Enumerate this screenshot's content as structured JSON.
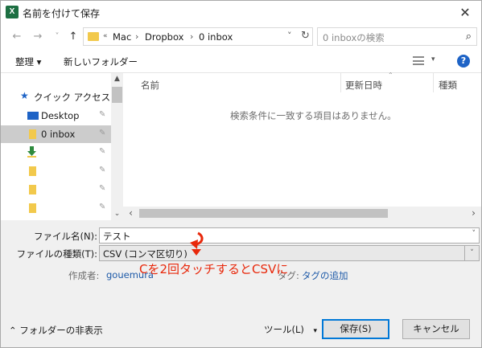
{
  "window": {
    "title": "名前を付けて保存",
    "app_icon_letter": "X",
    "close_glyph": "✕"
  },
  "nav": {
    "back_glyph": "←",
    "forward_glyph": "→",
    "recent_glyph": "˅",
    "up_glyph": "↑",
    "breadcrumb": [
      "Mac",
      "Dropbox",
      "0 inbox"
    ],
    "breadcrumb_sep": "›",
    "leading_sep": "«",
    "dropdown_glyph": "˅",
    "refresh_glyph": "↻",
    "search_placeholder": "0 inboxの検索",
    "search_glyph": "⌕"
  },
  "toolbar": {
    "organize_label": "整理 ▾",
    "new_folder_label": "新しいフォルダー",
    "view_drop_glyph": "▾",
    "help_glyph": "?"
  },
  "sidebar": {
    "items": [
      {
        "label": "クイック アクセス",
        "icon": "star-icon"
      },
      {
        "label": "Desktop",
        "icon": "desktop-icon"
      },
      {
        "label": "0 inbox",
        "icon": "folder-icon",
        "selected": true
      },
      {
        "label": "",
        "icon": "green-arrow-icon"
      },
      {
        "label": "",
        "icon": "folder-icon"
      },
      {
        "label": "",
        "icon": "folder-icon"
      },
      {
        "label": "",
        "icon": "folder-icon"
      }
    ],
    "pin_glyph": "📌",
    "scroll_up": "▲",
    "scroll_down": "⌄"
  },
  "filelist": {
    "columns": [
      "名前",
      "更新日時",
      "種類"
    ],
    "empty_message": "検索条件に一致する項目はありません。",
    "sort_glyph": "⌃",
    "scroll_left": "‹",
    "scroll_right": "›"
  },
  "form": {
    "filename_label": "ファイル名(N):",
    "filename_value": "テスト",
    "filetype_label": "ファイルの種類(T):",
    "filetype_value": "CSV (コンマ区切り)",
    "author_label": "作成者:",
    "author_value": "gouemura",
    "tags_label": "タグ:",
    "tags_link": "タグの追加",
    "drop_glyph": "˅"
  },
  "annotation": {
    "text": "Cを2回タッチするとCSVに",
    "color": "#e8280b"
  },
  "footer": {
    "hide_folders_label": "フォルダーの非表示",
    "hide_folders_glyph": "⌃",
    "tools_label": "ツール(L)",
    "tools_glyph": "▾",
    "save_label": "保存(S)",
    "cancel_label": "キャンセル"
  },
  "colors": {
    "accent": "#0078d7",
    "link": "#1e5aa8",
    "excel_green": "#1d6f42",
    "folder": "#f2c94c",
    "annotation": "#e8280b"
  }
}
